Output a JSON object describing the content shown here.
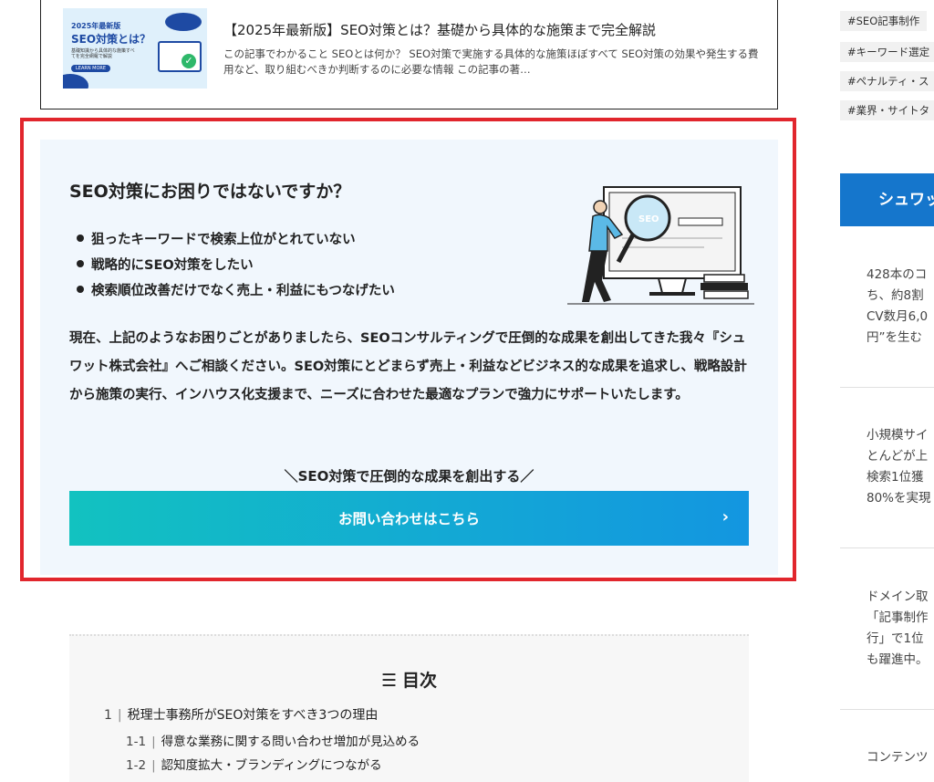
{
  "related_article": {
    "thumbnail": {
      "line1": "2025年最新版",
      "line2": "SEO対策とは？",
      "line3": "基礎知識から具体的な施策すべてを完全網羅で解説",
      "button": "LEARN MORE"
    },
    "title": "【2025年最新版】SEO対策とは？基礎から具体的な施策まで完全解説",
    "excerpt": "この記事でわかること SEOとは何か？ SEO対策で実施する具体的な施策ほぼすべて SEO対策の効果や発生する費用など、取り組むべきか判断するのに必要な情報 この記事の著…"
  },
  "cta": {
    "heading": "SEO対策にお困りではないですか？",
    "bullets": [
      "狙ったキーワードで検索上位がとれていない",
      "戦略的にSEO対策をしたい",
      "検索順位改善だけでなく売上・利益にもつなげたい"
    ],
    "body": "現在、上記のようなお困りごとがありましたら、SEOコンサルティングで圧倒的な成果を創出してきた我々『シュワット株式会社』へご相談ください。SEO対策にとどまらず売上・利益などビジネス的な成果を追求し、戦略設計から施策の実行、インハウス化支援まで、ニーズに合わせた最適なプランで強力にサポートいたします。",
    "tagline": "＼SEO対策で圧倒的な成果を創出する／",
    "button_label": "お問い合わせはこちら",
    "illustration_label": "SEO"
  },
  "toc": {
    "title": "目次",
    "items": [
      {
        "num": "1",
        "label": "税理士事務所がSEO対策をすべき3つの理由"
      },
      {
        "num": "1-1",
        "label": "得意な業務に関する問い合わせ増加が見込める"
      },
      {
        "num": "1-2",
        "label": "認知度拡大・ブランディングにつながる"
      }
    ]
  },
  "sidebar": {
    "tags": [
      "#SEO記事制作",
      "#キーワード選定",
      "#ペナルティ・ス",
      "#業界・サイトタ"
    ],
    "banner": "シュワッ",
    "snippets": [
      [
        "428本のコ",
        "ち、約8割",
        "CV数月6,0",
        "円”を生む"
      ],
      [
        "小規模サイ",
        "とんどが上",
        "検索1位獲",
        "80%を実現"
      ],
      [
        "ドメイン取",
        "「記事制作",
        "行」で1位",
        "も躍進中。"
      ],
      [
        "コンテンツ"
      ]
    ]
  },
  "colors": {
    "cta_frame": "#e1262d",
    "cta_background": "#f1f7fd",
    "button_gradient_start": "#12c2c0",
    "button_gradient_end": "#1396e0",
    "sidebar_banner": "#1576cc"
  }
}
